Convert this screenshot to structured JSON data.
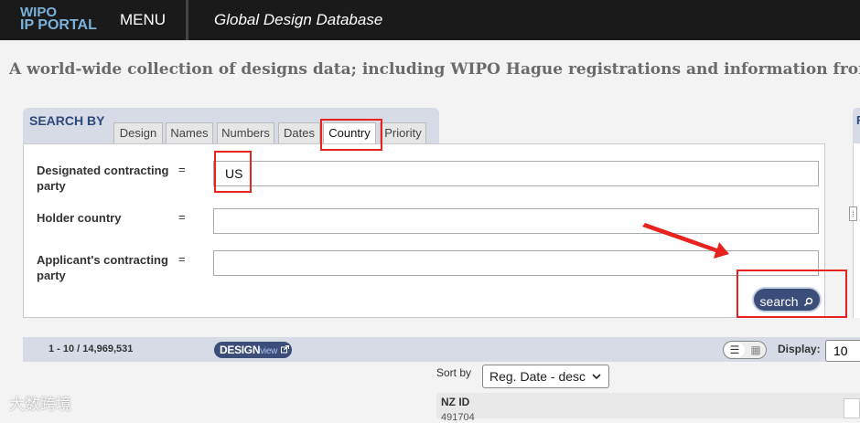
{
  "header": {
    "logo_line1": "WIPO",
    "logo_line2": "IP PORTAL",
    "menu_label": "MENU",
    "app_title": "Global Design Database"
  },
  "tagline": "A world-wide collection of designs data; including WIPO Hague registrations and information from p",
  "search": {
    "section_label": "SEARCH BY",
    "tabs": [
      "Design",
      "Names",
      "Numbers",
      "Dates",
      "Country",
      "Priority"
    ],
    "active_tab": "Country",
    "fields": [
      {
        "label": "Designated contracting party",
        "operator": "=",
        "value": "US"
      },
      {
        "label": "Holder country",
        "operator": "=",
        "value": ""
      },
      {
        "label": "Applicant's contracting party",
        "operator": "=",
        "value": ""
      }
    ],
    "search_button": "search"
  },
  "right_panel": {
    "label_fragment": "F",
    "handle_glyph": "⁞"
  },
  "results": {
    "count": "1 - 10 / 14,969,531",
    "designview_main": "DESIGN",
    "designview_sub": "view",
    "display_label": "Display:",
    "display_value": "10",
    "sort_label": "Sort by",
    "sort_value": "Reg. Date - desc",
    "column_header": "NZ ID",
    "first_value": "491704"
  },
  "watermark": "大数跨境",
  "colors": {
    "header_bg": "#1a1a1a",
    "logo": "#7ab2d9",
    "accent_navy": "#3a4e79",
    "panel_header": "#d6dbe6",
    "highlight": "#e8231f"
  },
  "icons": [
    "search-icon",
    "external-link-icon",
    "list-view-icon",
    "grid-view-icon",
    "dropdown-arrow-icon",
    "panel-handle-icon"
  ]
}
